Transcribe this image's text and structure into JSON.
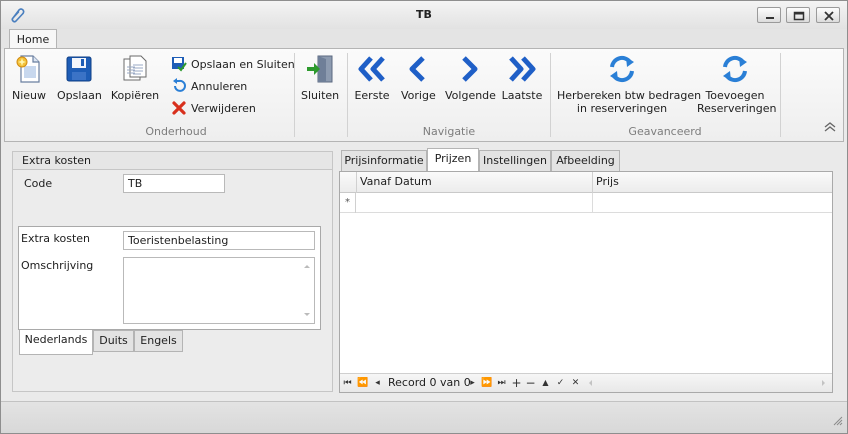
{
  "window": {
    "title": "TB"
  },
  "ribbon": {
    "tab_home": "Home",
    "groups": {
      "onderhoud": "Onderhoud",
      "navigatie": "Navigatie",
      "geavanceerd": "Geavanceerd"
    },
    "buttons": {
      "nieuw": "Nieuw",
      "opslaan": "Opslaan",
      "kopieeren": "Kopiëren",
      "opslaan_en_sluiten": "Opslaan en Sluiten",
      "annuleren": "Annuleren",
      "verwijderen": "Verwijderen",
      "sluiten": "Sluiten",
      "eerste": "Eerste",
      "vorige": "Vorige",
      "volgende": "Volgende",
      "laatste": "Laatste",
      "herbereken_line1": "Herbereken btw bedragen",
      "herbereken_line2": "in reserveringen",
      "toevoegen_line1": "Toevoegen",
      "toevoegen_line2": "Reserveringen"
    }
  },
  "left_panel": {
    "header": "Extra kosten",
    "code_label": "Code",
    "code_value": "TB",
    "extra_kosten_label": "Extra kosten",
    "extra_kosten_value": "Toeristenbelasting",
    "omschrijving_label": "Omschrijving",
    "omschrijving_value": "",
    "language_tabs": [
      "Nederlands",
      "Duits",
      "Engels"
    ],
    "active_language": "Nederlands"
  },
  "right_panel": {
    "tabs": [
      "Prijsinformatie",
      "Prijzen",
      "Instellingen",
      "Afbeelding"
    ],
    "active_tab": "Prijzen",
    "grid": {
      "columns": [
        "Vanaf Datum",
        "Prijs"
      ],
      "new_row_indicator": "*",
      "rows": []
    },
    "navigator": {
      "record_text": "Record 0 van 0"
    }
  },
  "colors": {
    "accent_blue": "#1f5fc7",
    "refresh_blue": "#2a7fd6",
    "delete_red": "#d8301d"
  }
}
